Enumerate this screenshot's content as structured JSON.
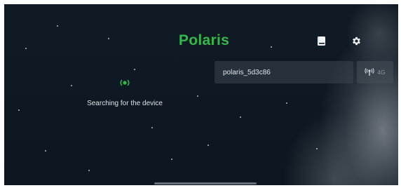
{
  "header": {
    "brand": "Polaris",
    "brand_color": "#35b84a",
    "manual_icon": "book-icon",
    "settings_icon": "gear-icon"
  },
  "device": {
    "name": "polaris_5d3c86",
    "network_icon": "antenna-signal-icon",
    "network_type": "4G"
  },
  "status": {
    "indicator_icon": "broadcast-icon",
    "indicator_color": "#35b84a",
    "message": "Searching for the device"
  }
}
